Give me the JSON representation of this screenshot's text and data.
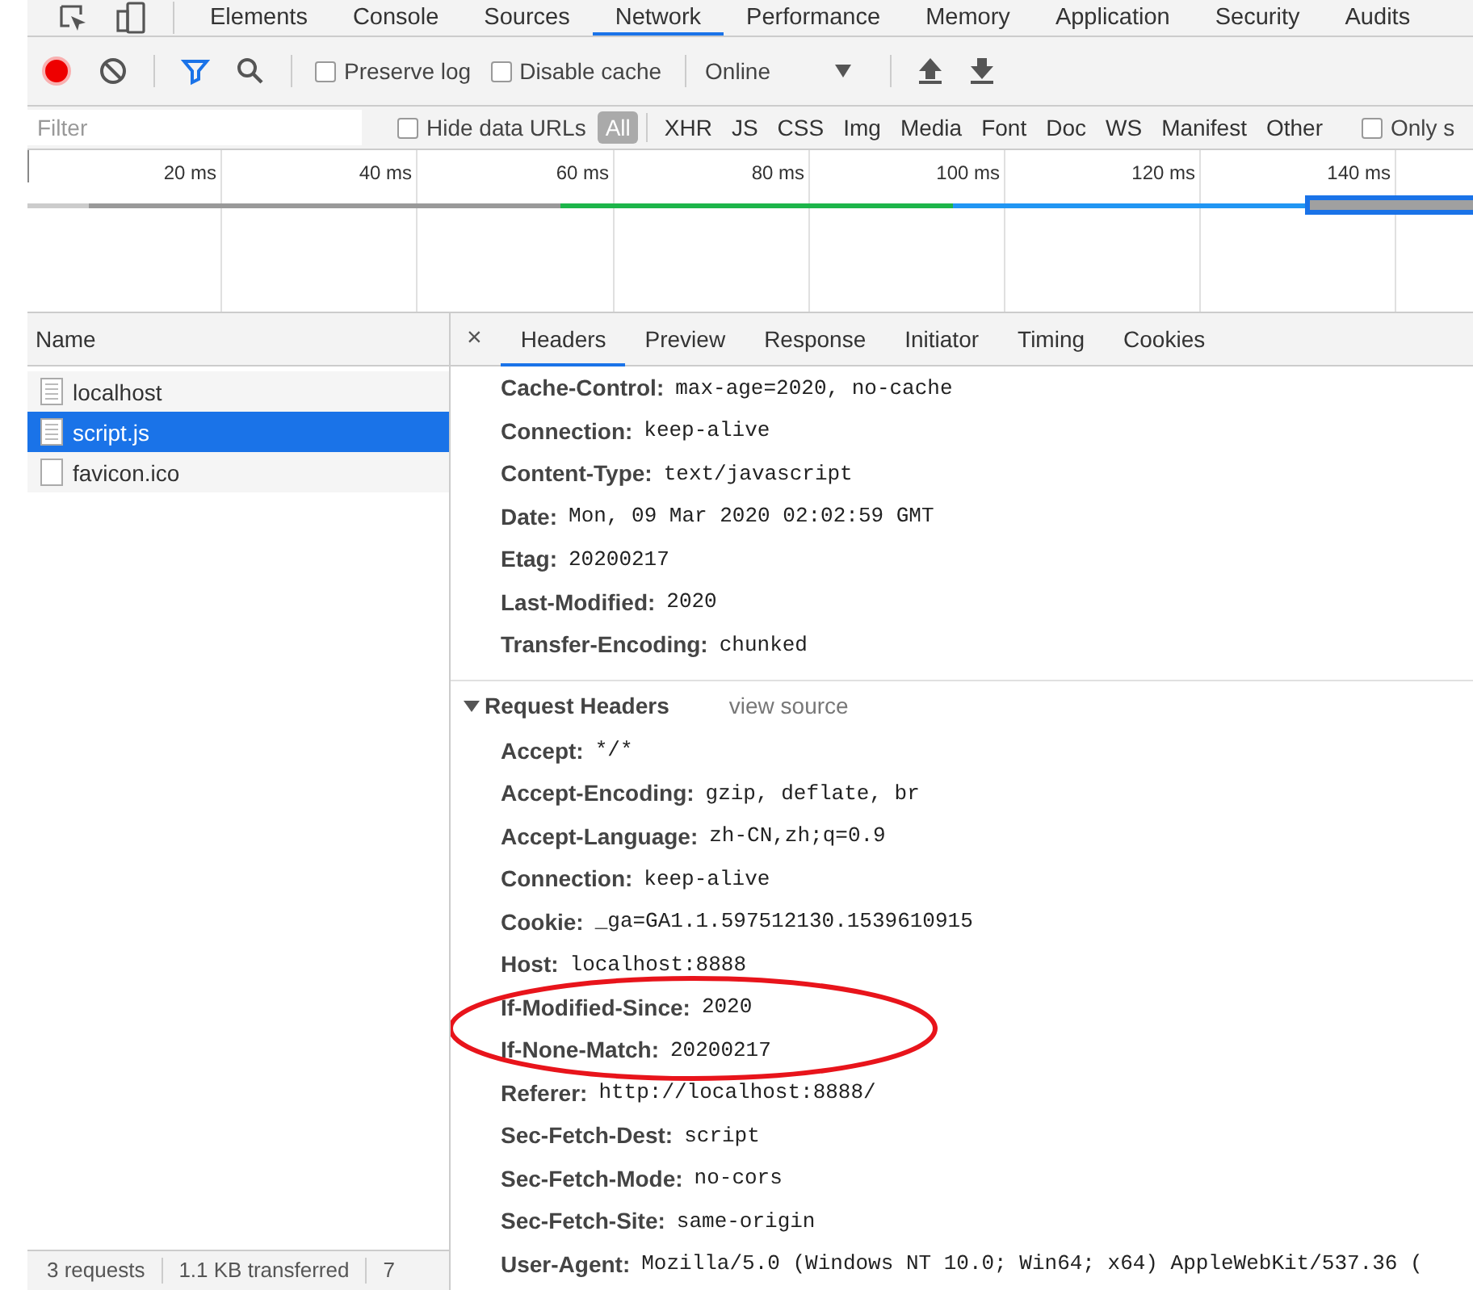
{
  "panel_tabs": [
    {
      "label": "Elements",
      "selected": false
    },
    {
      "label": "Console",
      "selected": false
    },
    {
      "label": "Sources",
      "selected": false
    },
    {
      "label": "Network",
      "selected": true
    },
    {
      "label": "Performance",
      "selected": false
    },
    {
      "label": "Memory",
      "selected": false
    },
    {
      "label": "Application",
      "selected": false
    },
    {
      "label": "Security",
      "selected": false
    },
    {
      "label": "Audits",
      "selected": false
    }
  ],
  "toolbar": {
    "recording": true,
    "options": [
      {
        "label": "Preserve log",
        "checked": false
      },
      {
        "label": "Disable cache",
        "checked": false
      }
    ],
    "throttle": "Online"
  },
  "filter_bar": {
    "placeholder": "Filter",
    "hide_data_urls": {
      "label": "Hide data URLs",
      "checked": false
    },
    "types": [
      {
        "label": "All",
        "selected": true
      },
      {
        "label": "XHR",
        "selected": false
      },
      {
        "label": "JS",
        "selected": false
      },
      {
        "label": "CSS",
        "selected": false
      },
      {
        "label": "Img",
        "selected": false
      },
      {
        "label": "Media",
        "selected": false
      },
      {
        "label": "Font",
        "selected": false
      },
      {
        "label": "Doc",
        "selected": false
      },
      {
        "label": "WS",
        "selected": false
      },
      {
        "label": "Manifest",
        "selected": false
      },
      {
        "label": "Other",
        "selected": false
      }
    ],
    "only": {
      "label": "Only s",
      "checked": false
    }
  },
  "timeline": {
    "ticks": [
      "20 ms",
      "40 ms",
      "60 ms",
      "80 ms",
      "100 ms",
      "120 ms",
      "140 ms"
    ]
  },
  "requests": {
    "column": "Name",
    "rows": [
      {
        "name": "localhost",
        "kind": "document",
        "selected": false
      },
      {
        "name": "script.js",
        "kind": "document",
        "selected": true
      },
      {
        "name": "favicon.ico",
        "kind": "blank",
        "selected": false
      }
    ]
  },
  "status_bar": [
    "3 requests",
    "1.1 KB transferred",
    "7"
  ],
  "detail": {
    "close": "×",
    "tabs": [
      {
        "label": "Headers",
        "selected": true
      },
      {
        "label": "Preview",
        "selected": false
      },
      {
        "label": "Response",
        "selected": false
      },
      {
        "label": "Initiator",
        "selected": false
      },
      {
        "label": "Timing",
        "selected": false
      },
      {
        "label": "Cookies",
        "selected": false
      }
    ],
    "response_headers": [
      {
        "name": "Cache-Control:",
        "value": "max-age=2020, no-cache"
      },
      {
        "name": "Connection:",
        "value": "keep-alive"
      },
      {
        "name": "Content-Type:",
        "value": "text/javascript"
      },
      {
        "name": "Date:",
        "value": "Mon, 09 Mar 2020 02:02:59 GMT"
      },
      {
        "name": "Etag:",
        "value": "20200217"
      },
      {
        "name": "Last-Modified:",
        "value": "2020"
      },
      {
        "name": "Transfer-Encoding:",
        "value": "chunked"
      }
    ],
    "request_section": {
      "title": "Request Headers",
      "expanded": true,
      "link": "view source",
      "headers": [
        {
          "name": "Accept:",
          "value": "*/*"
        },
        {
          "name": "Accept-Encoding:",
          "value": "gzip, deflate, br"
        },
        {
          "name": "Accept-Language:",
          "value": "zh-CN,zh;q=0.9"
        },
        {
          "name": "Connection:",
          "value": "keep-alive"
        },
        {
          "name": "Cookie:",
          "value": "_ga=GA1.1.597512130.1539610915"
        },
        {
          "name": "Host:",
          "value": "localhost:8888"
        },
        {
          "name": "If-Modified-Since:",
          "value": "2020"
        },
        {
          "name": "If-None-Match:",
          "value": "20200217"
        },
        {
          "name": "Referer:",
          "value": "http://localhost:8888/"
        },
        {
          "name": "Sec-Fetch-Dest:",
          "value": "script"
        },
        {
          "name": "Sec-Fetch-Mode:",
          "value": "no-cors"
        },
        {
          "name": "Sec-Fetch-Site:",
          "value": "same-origin"
        },
        {
          "name": "User-Agent:",
          "value": "Mozilla/5.0 (Windows NT 10.0; Win64; x64) AppleWebKit/537.36 ("
        }
      ]
    }
  }
}
